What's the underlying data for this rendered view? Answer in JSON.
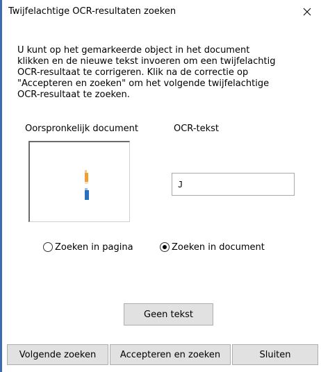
{
  "dialog": {
    "title": "Twijfelachtige OCR-resultaten zoeken",
    "instructions": "U kunt op het gemarkeerde object in het document\nklikken en de nieuwe tekst invoeren om een twijfelachtig\nOCR-resultaat te corrigeren. Klik na de correctie op\n\"Accepteren en zoeken\" om het volgende twijfelachtige\nOCR-resultaat te zoeken.",
    "original_label": "Oorspronkelijk document",
    "ocr_label": "OCR-tekst",
    "ocr_value": "J",
    "radios": {
      "page_label": "Zoeken in pagina",
      "document_label": "Zoeken in document",
      "selected": "document"
    },
    "buttons": {
      "no_text": "Geen tekst",
      "find_next": "Volgende zoeken",
      "accept_find": "Accepteren en zoeken",
      "close": "Sluiten"
    }
  },
  "colors": {
    "window_border": "#3c6bb0",
    "button_face": "#e1e1e1",
    "snippet_orange": "#f0a030",
    "snippet_blue": "#2a6fc0"
  }
}
